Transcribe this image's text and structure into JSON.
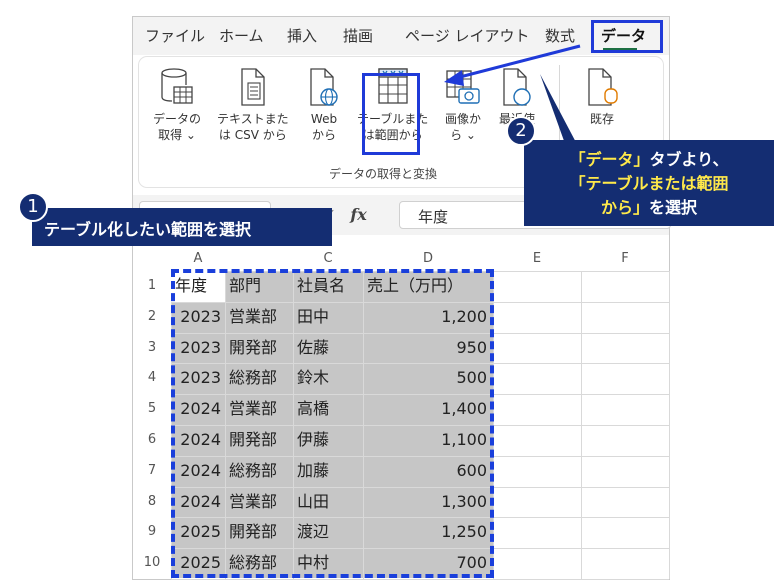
{
  "ribbon_tabs": [
    {
      "label": "ファイル",
      "active": false
    },
    {
      "label": "ホーム",
      "active": false
    },
    {
      "label": "挿入",
      "active": false
    },
    {
      "label": "描画",
      "active": false
    },
    {
      "label": "ページ レイアウト",
      "active": false
    },
    {
      "label": "数式",
      "active": false
    },
    {
      "label": "データ",
      "active": true
    }
  ],
  "ribbon_buttons": [
    {
      "line1": "データの",
      "line2": "取得 ⌄",
      "icon": "database-table-icon"
    },
    {
      "line1": "テキストまた",
      "line2": "は CSV から",
      "icon": "text-file-icon"
    },
    {
      "line1": "Web",
      "line2": "から",
      "icon": "web-globe-icon"
    },
    {
      "line1": "テーブルまた",
      "line2": "は範囲から",
      "icon": "table-range-icon"
    },
    {
      "line1": "画像か",
      "line2": "ら ⌄",
      "icon": "image-camera-icon"
    },
    {
      "line1": "最近使",
      "line2": "",
      "icon": "recent-sources-icon"
    },
    {
      "line1": "既存",
      "line2": "",
      "icon": "existing-connections-icon"
    }
  ],
  "ribbon_group_label": "データの取得と変換",
  "formula_bar": {
    "fx_label": "fx",
    "value": "年度"
  },
  "columns": [
    "A",
    "C",
    "D",
    "E",
    "F"
  ],
  "row_numbers": [
    "1",
    "2",
    "3",
    "4",
    "5",
    "6",
    "7",
    "8",
    "9",
    "10"
  ],
  "table": {
    "header": [
      "年度",
      "部門",
      "社員名",
      "売上（万円）"
    ],
    "rows": [
      [
        "2023",
        "営業部",
        "田中",
        "1,200"
      ],
      [
        "2023",
        "開発部",
        "佐藤",
        "950"
      ],
      [
        "2023",
        "総務部",
        "鈴木",
        "500"
      ],
      [
        "2024",
        "営業部",
        "高橋",
        "1,400"
      ],
      [
        "2024",
        "開発部",
        "伊藤",
        "1,100"
      ],
      [
        "2024",
        "総務部",
        "加藤",
        "600"
      ],
      [
        "2024",
        "営業部",
        "山田",
        "1,300"
      ],
      [
        "2025",
        "開発部",
        "渡辺",
        "1,250"
      ],
      [
        "2025",
        "総務部",
        "中村",
        "700"
      ]
    ]
  },
  "callouts": {
    "step1_number": "1",
    "step1_text": "テーブル化したい範囲を選択",
    "step2_number": "2",
    "step2_line1_a": "「データ」",
    "step2_line1_b": "タブより、",
    "step2_line2": "「テーブルまたは範囲",
    "step2_line3_a": "から」",
    "step2_line3_b": "を選択"
  },
  "colors": {
    "highlight_blue": "#1f3ad8",
    "callout_navy": "#142d72",
    "callout_yellow": "#ffe94a",
    "selection_gray": "#c6c6c6"
  }
}
